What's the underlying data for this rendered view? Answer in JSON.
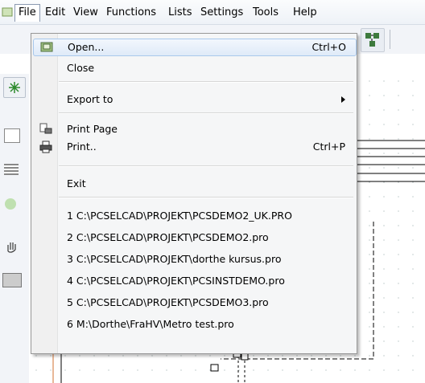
{
  "menubar": {
    "items": [
      {
        "label": "File"
      },
      {
        "label": "Edit"
      },
      {
        "label": "View"
      },
      {
        "label": "Functions"
      },
      {
        "label": "Lists"
      },
      {
        "label": "Settings"
      },
      {
        "label": "Tools"
      },
      {
        "label": "Help"
      }
    ]
  },
  "file_menu": {
    "open": {
      "label": "Open...",
      "shortcut": "Ctrl+O",
      "icon": "open-folder-icon"
    },
    "close": {
      "label": "Close"
    },
    "export": {
      "label": "Export to",
      "icon": "submenu-arrow-icon"
    },
    "print_page": {
      "label": "Print Page",
      "icon": "print-page-icon"
    },
    "print": {
      "label": "Print..",
      "shortcut": "Ctrl+P",
      "icon": "printer-icon"
    },
    "exit": {
      "label": "Exit"
    },
    "recent": [
      "1 C:\\PCSELCAD\\PROJEKT\\PCSDEMO2_UK.PRO",
      "2 C:\\PCSELCAD\\PROJEKT\\PCSDEMO2.pro",
      "3 C:\\PCSELCAD\\PROJEKT\\dorthe kursus.pro",
      "4 C:\\PCSELCAD\\PROJEKT\\PCSINSTDEMO.pro",
      "5 C:\\PCSELCAD\\PROJEKT\\PCSDEMO3.pro",
      "6 M:\\Dorthe\\FraHV\\Metro test.pro"
    ]
  },
  "colors": {
    "highlight": "#dfeaf8",
    "menu_bg": "#f5f6f7"
  }
}
